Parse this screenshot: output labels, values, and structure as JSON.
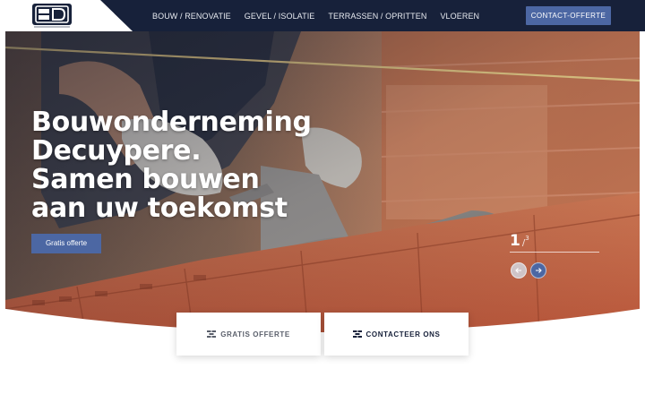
{
  "header": {
    "logo_text": "BD",
    "nav": [
      {
        "label": "BOUW / RENOVATIE"
      },
      {
        "label": "GEVEL / ISOLATIE"
      },
      {
        "label": "TERRASSEN / OPRITTEN"
      },
      {
        "label": "VLOEREN"
      }
    ],
    "cta_label": "CONTACT-OFFERTE"
  },
  "hero": {
    "title_lines": [
      "Bouwonderneming",
      "Decuypere.",
      "Samen bouwen",
      "aan uw toekomst"
    ],
    "button_label": "Gratis offerte",
    "slider": {
      "current": "1",
      "separator": "/",
      "total": "3"
    }
  },
  "cards": [
    {
      "label": "GRATIS OFFERTE",
      "icon": "brick-icon"
    },
    {
      "label": "CONTACTEER ONS",
      "icon": "brick-icon"
    }
  ],
  "colors": {
    "navy": "#17213a",
    "accent": "#4c67a3",
    "brick": "#c2552f"
  }
}
